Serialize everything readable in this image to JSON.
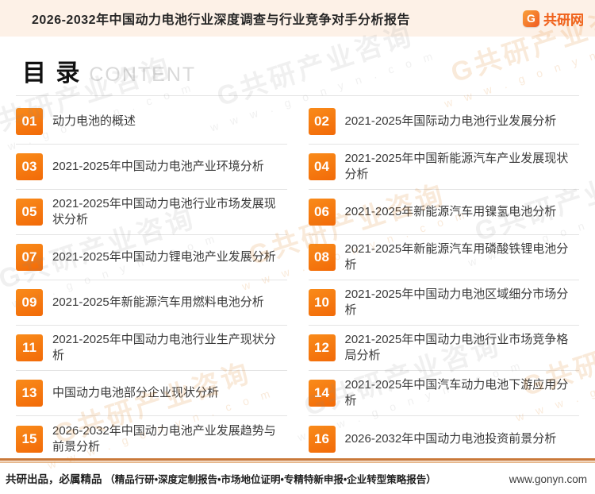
{
  "header": {
    "title": "2026-2032年中国动力电池行业深度调查与行业竞争对手分析报告",
    "logo_letter": "G",
    "logo_text": "共研网"
  },
  "page_heading": {
    "cn": "目 录",
    "en": "CONTENT"
  },
  "toc": {
    "left": [
      {
        "num": "01",
        "title": "动力电池的概述"
      },
      {
        "num": "03",
        "title": "2021-2025年中国动力电池产业环境分析"
      },
      {
        "num": "05",
        "title": "2021-2025年中国动力电池行业市场发展现状分析"
      },
      {
        "num": "07",
        "title": "2021-2025年中国动力锂电池产业发展分析"
      },
      {
        "num": "09",
        "title": "2021-2025年新能源汽车用燃料电池分析"
      },
      {
        "num": "11",
        "title": "2021-2025年中国动力电池行业生产现状分析"
      },
      {
        "num": "13",
        "title": "中国动力电池部分企业现状分析"
      },
      {
        "num": "15",
        "title": "2026-2032年中国动力电池产业发展趋势与前景分析"
      }
    ],
    "right": [
      {
        "num": "02",
        "title": "2021-2025年国际动力电池行业发展分析"
      },
      {
        "num": "04",
        "title": "2021-2025年中国新能源汽车产业发展现状分析"
      },
      {
        "num": "06",
        "title": "2021-2025年新能源汽车用镍氢电池分析"
      },
      {
        "num": "08",
        "title": "2021-2025年新能源汽车用磷酸铁锂电池分析"
      },
      {
        "num": "10",
        "title": "2021-2025年中国动力电池区域细分市场分析"
      },
      {
        "num": "12",
        "title": "2021-2025年中国动力电池行业市场竞争格局分析"
      },
      {
        "num": "14",
        "title": "2021-2025年中国汽车动力电池下游应用分析"
      },
      {
        "num": "16",
        "title": "2026-2032年中国动力电池投资前景分析"
      }
    ]
  },
  "watermark": {
    "line1": "G共研产业咨询",
    "line2": "w w w . g o n y n . c o m"
  },
  "footer": {
    "brand": "共研出品，必属精品",
    "detail": "（精品行研•深度定制报告•市场地位证明•专精特新申报•企业转型策略报告）",
    "url": "www.gonyn.com"
  },
  "colors": {
    "accent_orange": "#f26a08",
    "header_bg": "#fdf1e7",
    "separator": "#e4e4e4",
    "footer_line": "#c97839"
  }
}
